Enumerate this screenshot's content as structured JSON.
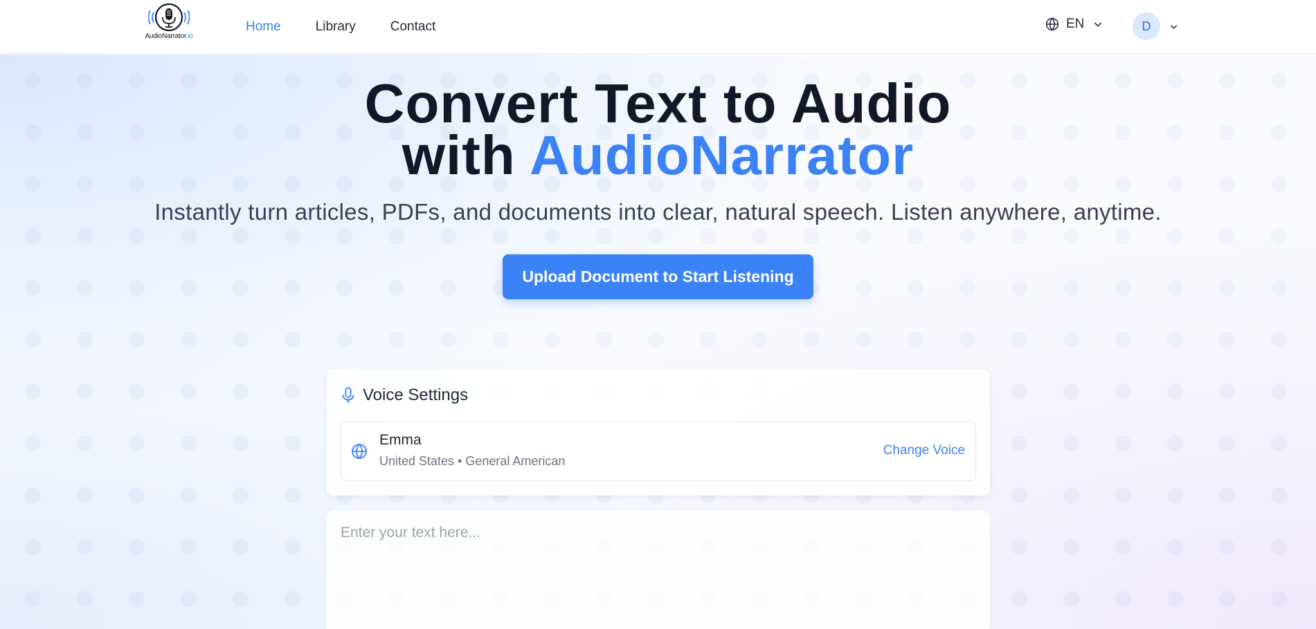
{
  "header": {
    "logo_text": "AudioNarrator",
    "logo_suffix": ".io",
    "nav": [
      {
        "label": "Home",
        "active": true
      },
      {
        "label": "Library",
        "active": false
      },
      {
        "label": "Contact",
        "active": false
      }
    ],
    "language": "EN",
    "user_initial": "D"
  },
  "hero": {
    "title_line1": "Convert Text to Audio",
    "title_line2_prefix": "with ",
    "title_brand": "AudioNarrator",
    "subtitle": "Instantly turn articles, PDFs, and documents into clear, natural speech. Listen anywhere, anytime.",
    "upload_button": "Upload Document to Start Listening"
  },
  "voice_settings": {
    "title": "Voice Settings",
    "voice_name": "Emma",
    "voice_meta": "United States • General American",
    "change_voice": "Change Voice"
  },
  "text_input": {
    "placeholder": "Enter your text here...",
    "value": ""
  },
  "colors": {
    "accent": "#3b82f6",
    "nav_active": "#3b7de6",
    "heading": "#111827",
    "muted": "#6b7280"
  },
  "icons": {
    "logo": "microphone-logo-icon",
    "language": "globe-icon",
    "dropdown": "chevron-down-icon",
    "voice_settings": "microphone-icon",
    "voice": "globe-icon"
  }
}
